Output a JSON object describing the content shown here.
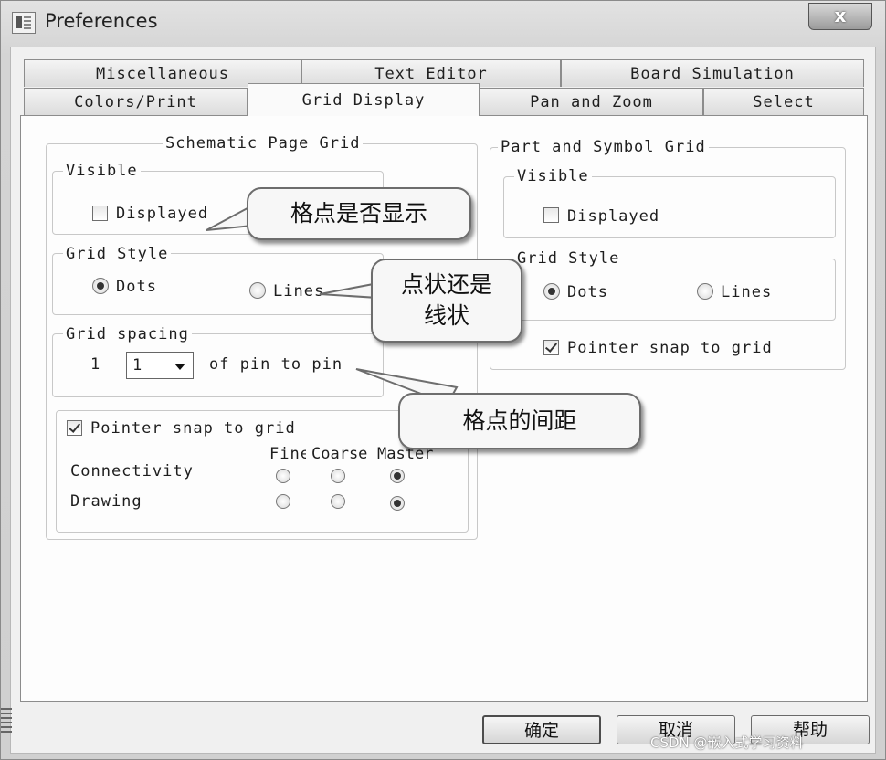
{
  "window": {
    "title": "Preferences",
    "close_label": "x"
  },
  "tabs": {
    "row_top": [
      "Miscellaneous",
      "Text Editor",
      "Board Simulation"
    ],
    "row_bottom": [
      "Colors/Print",
      "Grid Display",
      "Pan and Zoom",
      "Select"
    ],
    "active": "Grid Display"
  },
  "schematic": {
    "title": "Schematic Page Grid",
    "visible": {
      "label": "Visible",
      "displayed_label": "Displayed",
      "displayed": false
    },
    "grid_style": {
      "label": "Grid Style",
      "options": [
        "Dots",
        "Lines"
      ],
      "selected": "Dots"
    },
    "grid_spacing": {
      "label": "Grid spacing",
      "value": "1",
      "select_value": "1",
      "suffix": "of pin to pin"
    },
    "pointer_snap": {
      "label": "Pointer snap to grid",
      "checked": true
    },
    "snap_table": {
      "columns": [
        "Fine",
        "Coarse",
        "Master"
      ],
      "rows": [
        {
          "label": "Connectivity",
          "selected": "Master"
        },
        {
          "label": "Drawing",
          "selected": "Master"
        }
      ]
    }
  },
  "part_symbol": {
    "title": "Part and Symbol Grid",
    "visible": {
      "label": "Visible",
      "displayed_label": "Displayed",
      "displayed": false
    },
    "grid_style": {
      "label": "Grid Style",
      "options": [
        "Dots",
        "Lines"
      ],
      "selected": "Dots"
    },
    "pointer_snap": {
      "label": "Pointer snap to grid",
      "checked": true
    }
  },
  "callouts": {
    "displayed": "格点是否显示",
    "style": "点状还是线状",
    "spacing": "格点的间距"
  },
  "buttons": {
    "ok": "确定",
    "cancel": "取消",
    "help": "帮助"
  },
  "watermark": "CSDN @嵌入式学习资料"
}
